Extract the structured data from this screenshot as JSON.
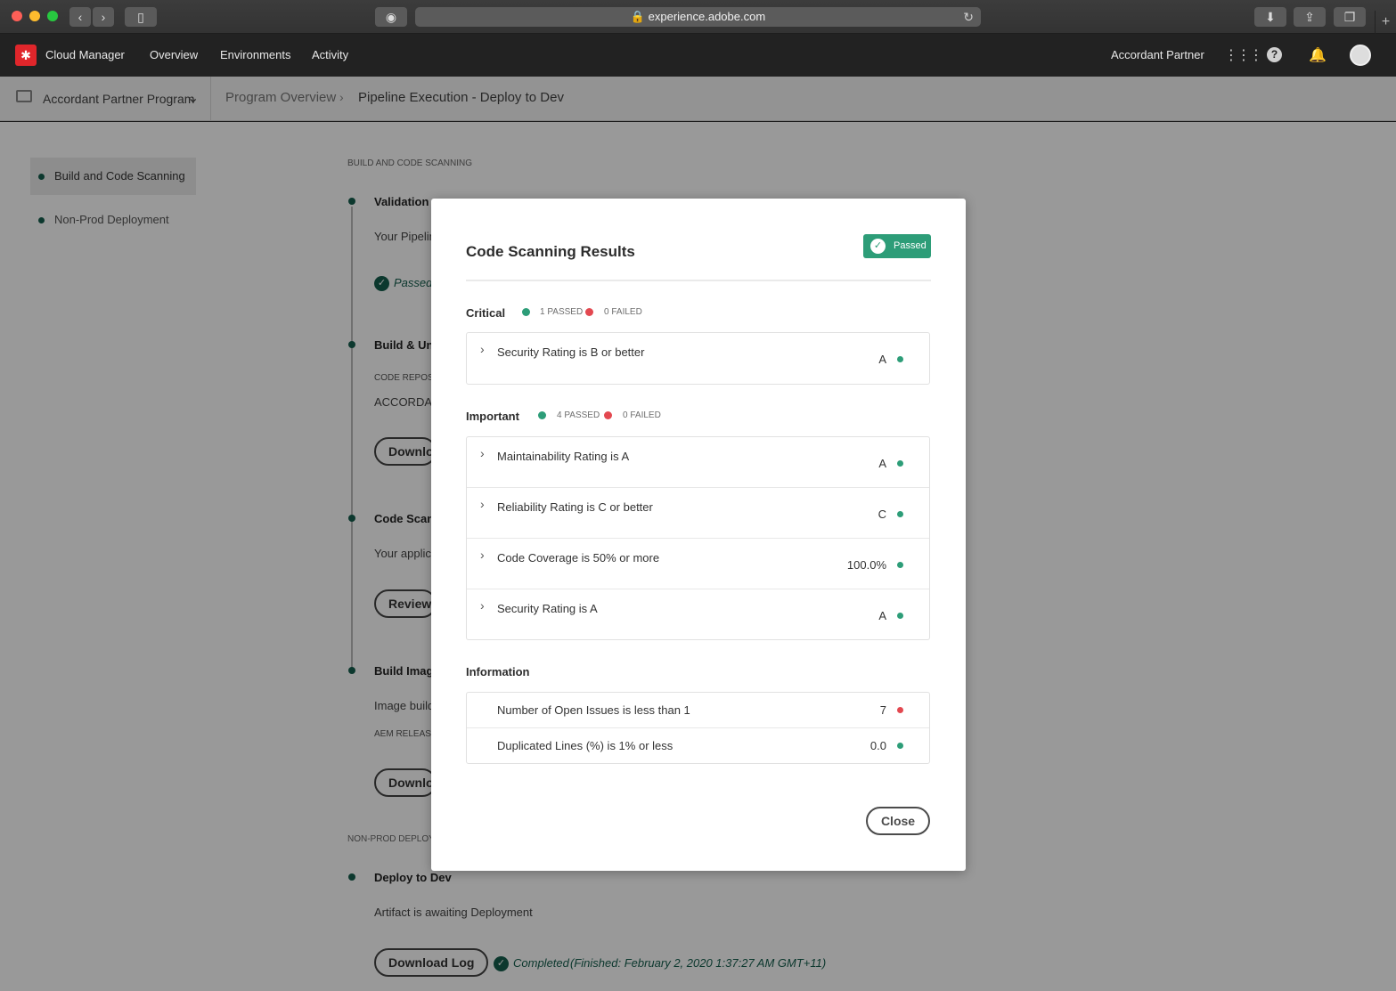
{
  "browser": {
    "url": "experience.adobe.com",
    "icons": [
      "back-icon",
      "forward-icon",
      "sidebar-icon",
      "privacy-icon",
      "lock-icon",
      "reload-icon",
      "download-icon",
      "share-icon",
      "tabs-icon",
      "new-tab-icon"
    ]
  },
  "app": {
    "name": "Cloud Manager",
    "nav": [
      "Overview",
      "Environments",
      "Activity"
    ],
    "org": "Accordant Partner"
  },
  "subheader": {
    "program": "Accordant Partner Program",
    "breadcrumb": [
      "Program Overview",
      "Pipeline Execution - Deploy to Dev"
    ]
  },
  "sidebar": {
    "items": [
      {
        "label": "Build and Code Scanning",
        "active": true
      },
      {
        "label": "Non-Prod Deployment",
        "active": false
      }
    ]
  },
  "page": {
    "section1": "BUILD AND CODE SCANNING",
    "validation": {
      "title": "Validation",
      "text": "Your Pipelin",
      "status": "Passed"
    },
    "build_unit": {
      "title": "Build & Un",
      "label": "CODE REPOSIT",
      "value": "ACCORDANT",
      "button": "Downlo"
    },
    "code_scan": {
      "title": "Code Scann",
      "text": "Your applica",
      "button": "Review"
    },
    "build_image": {
      "title": "Build Imag",
      "text": "Image build",
      "label": "AEM RELEASE",
      "button": "Downlo"
    },
    "section2": "NON-PROD DEPLOY",
    "deploy": {
      "title": "Deploy to Dev",
      "text": "Artifact is awaiting Deployment",
      "button": "Download Log",
      "status": "Completed",
      "finished": "(Finished: February 2, 2020 1:37:27 AM GMT+11)"
    }
  },
  "modal": {
    "title": "Code Scanning Results",
    "badge": "Passed",
    "critical": {
      "title": "Critical",
      "passed": "1 PASSED",
      "failed": "0 FAILED",
      "rows": [
        {
          "label": "Security Rating is B or better",
          "value": "A",
          "status": "pass"
        }
      ]
    },
    "important": {
      "title": "Important",
      "passed": "4 PASSED",
      "failed": "0 FAILED",
      "rows": [
        {
          "label": "Maintainability Rating is A",
          "value": "A",
          "status": "pass"
        },
        {
          "label": "Reliability Rating is C or better",
          "value": "C",
          "status": "pass"
        },
        {
          "label": "Code Coverage is 50% or more",
          "value": "100.0%",
          "status": "pass"
        },
        {
          "label": "Security Rating is A",
          "value": "A",
          "status": "pass"
        }
      ]
    },
    "information": {
      "title": "Information",
      "rows": [
        {
          "label": "Number of Open Issues is less than 1",
          "value": "7",
          "status": "fail"
        },
        {
          "label": "Duplicated Lines (%) is 1% or less",
          "value": "0.0",
          "status": "pass"
        }
      ]
    },
    "close": "Close"
  },
  "colors": {
    "pass": "#2d9d78",
    "fail": "#e34850",
    "brand": "#e0262b"
  }
}
